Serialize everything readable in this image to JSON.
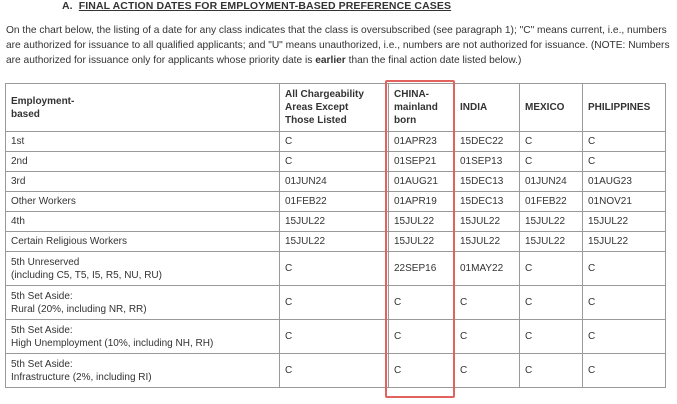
{
  "section": {
    "marker": "A.",
    "title": "FINAL ACTION DATES FOR EMPLOYMENT-BASED PREFERENCE CASES"
  },
  "intro": {
    "text_before": "On the chart below, the listing of a date for any class indicates that the class is oversubscribed (see paragraph 1); \"C\" means current, i.e., numbers are authorized for issuance to all qualified applicants; and \"U\" means unauthorized, i.e., numbers are not authorized for issuance. (NOTE: Numbers are authorized for issuance only for applicants whose priority date is ",
    "emphasis": "earlier",
    "text_after": " than the final action date listed below.)"
  },
  "table": {
    "headers": [
      "Employment-\nbased",
      "All Chargeability\nAreas Except\nThose Listed",
      "CHINA-\nmainland\nborn",
      "INDIA",
      "MEXICO",
      "PHILIPPINES"
    ],
    "rows": [
      [
        "1st",
        "C",
        "01APR23",
        "15DEC22",
        "C",
        "C"
      ],
      [
        "2nd",
        "C",
        "01SEP21",
        "01SEP13",
        "C",
        "C"
      ],
      [
        "3rd",
        "01JUN24",
        "01AUG21",
        "15DEC13",
        "01JUN24",
        "01AUG23"
      ],
      [
        "Other Workers",
        "01FEB22",
        "01APR19",
        "15DEC13",
        "01FEB22",
        "01NOV21"
      ],
      [
        "4th",
        "15JUL22",
        "15JUL22",
        "15JUL22",
        "15JUL22",
        "15JUL22"
      ],
      [
        "Certain Religious Workers",
        "15JUL22",
        "15JUL22",
        "15JUL22",
        "15JUL22",
        "15JUL22"
      ],
      [
        "5th Unreserved\n(including C5, T5, I5, R5, NU, RU)",
        "C",
        "22SEP16",
        "01MAY22",
        "C",
        "C"
      ],
      [
        "5th Set Aside:\nRural (20%, including NR, RR)",
        "C",
        "C",
        "C",
        "C",
        "C"
      ],
      [
        "5th Set Aside:\nHigh Unemployment (10%, including NH, RH)",
        "C",
        "C",
        "C",
        "C",
        "C"
      ],
      [
        "5th Set Aside:\nInfrastructure (2%, including RI)",
        "C",
        "C",
        "C",
        "C",
        "C"
      ]
    ]
  },
  "highlight": {
    "column": "CHINA-mainland born",
    "color": "#e2625d"
  }
}
